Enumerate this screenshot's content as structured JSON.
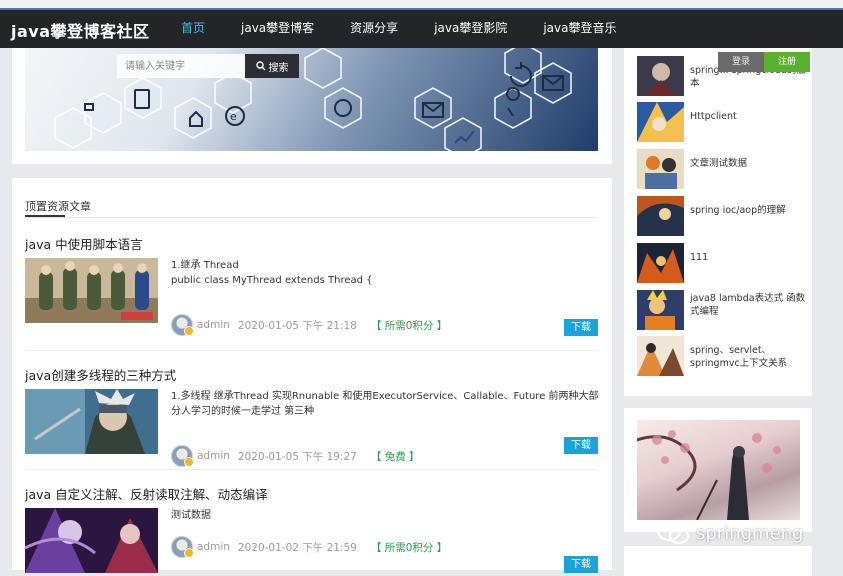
{
  "header": {
    "brand": "java攀登博客社区",
    "nav": [
      {
        "label": "首页",
        "active": true
      },
      {
        "label": "java攀登博客",
        "active": false
      },
      {
        "label": "资源分享",
        "active": false
      },
      {
        "label": "java攀登影院",
        "active": false
      },
      {
        "label": "java攀登音乐",
        "active": false
      }
    ]
  },
  "search": {
    "placeholder": "请输入关键字",
    "button_label": "搜索"
  },
  "auth": {
    "login_label": "登录",
    "register_label": "注册"
  },
  "main": {
    "section_title": "顶置资源文章",
    "articles": [
      {
        "title": "java 中使用脚本语言",
        "excerpt": "1.继承 Thread\npublic class MyThread extends Thread {",
        "author": "admin",
        "date": "2020-01-05 下午 21:18",
        "score": "【 所需0积分 】",
        "download_label": "下载"
      },
      {
        "title": "java创建多线程的三种方式",
        "excerpt": "1.多线程 继承Thread 实现Rnunable 和使用ExecutorService、Callable、Future 前两种大部分人学习的时候一走学过 第三种",
        "author": "admin",
        "date": "2020-01-05 下午 19:27",
        "score": "【 免费 】",
        "download_label": "下载"
      },
      {
        "title": "java 自定义注解、反射读取注解、动态编译",
        "excerpt": "测试数据",
        "author": "admin",
        "date": "2020-01-02 下午 21:59",
        "score": "【 所需0积分 】",
        "download_label": "下载"
      }
    ]
  },
  "sidebar": {
    "items": [
      {
        "label": "spring... springcloud的版本"
      },
      {
        "label": "Httpclient"
      },
      {
        "label": "文章测试数据"
      },
      {
        "label": "spring ioc/aop的理解"
      },
      {
        "label": "111"
      },
      {
        "label": "java8 lambda表达式 函数式编程"
      },
      {
        "label": "spring、servlet、springmvc上下文关系"
      }
    ]
  },
  "watermark": {
    "text": "springmeng"
  },
  "colors": {
    "nav_bg": "#232528",
    "nav_active": "#3fc3e6",
    "download": "#1aa3d9",
    "register": "#58b12f",
    "score": "#2c9a4c"
  }
}
